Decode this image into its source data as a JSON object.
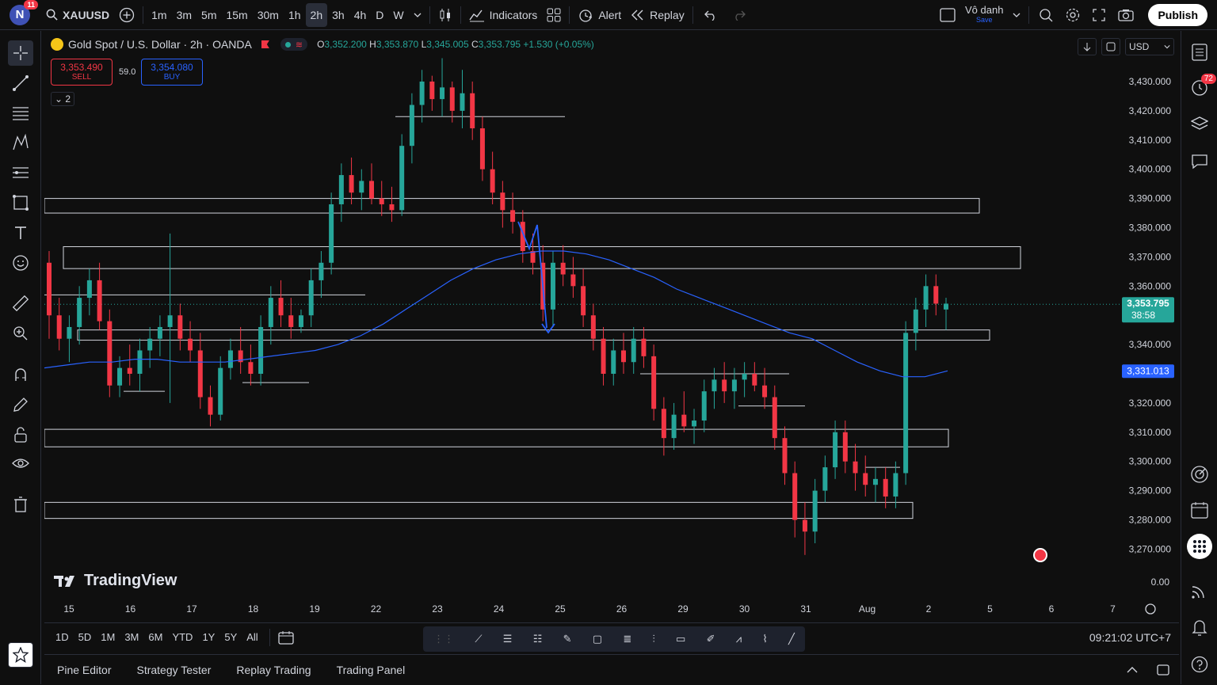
{
  "app": {
    "avatar_letter": "N",
    "notifications": "11",
    "symbol": "XAUUSD",
    "intervals": [
      "1m",
      "3m",
      "5m",
      "15m",
      "30m",
      "1h",
      "2h",
      "3h",
      "4h",
      "D",
      "W"
    ],
    "active_interval": "2h",
    "indicators_label": "Indicators",
    "alert_label": "Alert",
    "replay_label": "Replay",
    "layout_name": "Vô danh",
    "layout_status": "Save",
    "publish_label": "Publish"
  },
  "legend": {
    "title": "Gold Spot / U.S. Dollar · 2h · OANDA",
    "o_label": "O",
    "o": "3,352.200",
    "h_label": "H",
    "h": "3,353.870",
    "l_label": "L",
    "l": "3,345.005",
    "c_label": "C",
    "c": "3,353.795",
    "change": "+1.530 (+0.05%)",
    "sell_price": "3,353.490",
    "sell_label": "SELL",
    "spread": "59.0",
    "buy_price": "3,354.080",
    "buy_label": "BUY",
    "collapse_count": "2"
  },
  "price_scale": {
    "currency": "USD",
    "ticks": [
      "3,430.000",
      "3,420.000",
      "3,410.000",
      "3,400.000",
      "3,390.000",
      "3,380.000",
      "3,370.000",
      "3,360.000",
      "3,350.000",
      "3,340.000",
      "3,320.000",
      "3,310.000",
      "3,300.000",
      "3,290.000",
      "3,280.000",
      "3,270.000"
    ],
    "current_price": "3,353.795",
    "countdown": "38:58",
    "ma_price": "3,331.013",
    "zero_label": "0.00"
  },
  "time_scale": {
    "labels": [
      "15",
      "16",
      "17",
      "18",
      "19",
      "22",
      "23",
      "24",
      "25",
      "26",
      "29",
      "30",
      "31",
      "Aug",
      "2",
      "5",
      "6",
      "7"
    ]
  },
  "bottom": {
    "ranges": [
      "1D",
      "5D",
      "1M",
      "3M",
      "6M",
      "YTD",
      "1Y",
      "5Y",
      "All"
    ],
    "clock": "09:21:02 UTC+7"
  },
  "panels": [
    "Pine Editor",
    "Strategy Tester",
    "Replay Trading",
    "Trading Panel"
  ],
  "watermark": "TradingView",
  "right_badge": "72",
  "colors": {
    "up": "#26a69a",
    "down": "#f23645",
    "ma": "#2962ff",
    "bg": "#0f0f0f"
  },
  "chart_data": {
    "type": "candlestick",
    "title": "Gold Spot / U.S. Dollar · 2h · OANDA",
    "ylim": [
      3265,
      3440
    ],
    "ma_last": 3331.013,
    "last_close": 3353.795,
    "candles": [
      [
        3368,
        3372,
        3342,
        3350
      ],
      [
        3350,
        3356,
        3338,
        3342
      ],
      [
        3342,
        3350,
        3334,
        3346
      ],
      [
        3346,
        3360,
        3340,
        3356
      ],
      [
        3356,
        3366,
        3350,
        3362
      ],
      [
        3362,
        3368,
        3345,
        3348
      ],
      [
        3348,
        3352,
        3322,
        3326
      ],
      [
        3326,
        3336,
        3322,
        3332
      ],
      [
        3332,
        3340,
        3326,
        3330
      ],
      [
        3330,
        3342,
        3324,
        3338
      ],
      [
        3338,
        3346,
        3332,
        3342
      ],
      [
        3342,
        3350,
        3336,
        3346
      ],
      [
        3346,
        3378,
        3320,
        3350
      ],
      [
        3350,
        3354,
        3338,
        3342
      ],
      [
        3342,
        3348,
        3334,
        3338
      ],
      [
        3338,
        3344,
        3318,
        3322
      ],
      [
        3322,
        3326,
        3312,
        3316
      ],
      [
        3316,
        3336,
        3314,
        3332
      ],
      [
        3332,
        3342,
        3328,
        3338
      ],
      [
        3338,
        3346,
        3330,
        3334
      ],
      [
        3334,
        3340,
        3326,
        3330
      ],
      [
        3330,
        3350,
        3326,
        3346
      ],
      [
        3346,
        3360,
        3340,
        3356
      ],
      [
        3356,
        3362,
        3346,
        3350
      ],
      [
        3350,
        3356,
        3342,
        3346
      ],
      [
        3346,
        3352,
        3344,
        3350
      ],
      [
        3350,
        3366,
        3346,
        3362
      ],
      [
        3362,
        3372,
        3356,
        3368
      ],
      [
        3368,
        3392,
        3364,
        3388
      ],
      [
        3388,
        3402,
        3382,
        3398
      ],
      [
        3398,
        3404,
        3388,
        3392
      ],
      [
        3392,
        3400,
        3386,
        3396
      ],
      [
        3396,
        3402,
        3388,
        3390
      ],
      [
        3390,
        3396,
        3384,
        3388
      ],
      [
        3388,
        3394,
        3382,
        3386
      ],
      [
        3386,
        3412,
        3384,
        3408
      ],
      [
        3408,
        3426,
        3402,
        3422
      ],
      [
        3422,
        3434,
        3416,
        3430
      ],
      [
        3430,
        3432,
        3420,
        3424
      ],
      [
        3424,
        3438,
        3418,
        3428
      ],
      [
        3428,
        3430,
        3416,
        3420
      ],
      [
        3420,
        3434,
        3414,
        3426
      ],
      [
        3426,
        3430,
        3410,
        3414
      ],
      [
        3414,
        3418,
        3396,
        3400
      ],
      [
        3400,
        3406,
        3388,
        3392
      ],
      [
        3392,
        3396,
        3380,
        3386
      ],
      [
        3386,
        3392,
        3378,
        3382
      ],
      [
        3382,
        3386,
        3368,
        3372
      ],
      [
        3372,
        3378,
        3364,
        3368
      ],
      [
        3368,
        3374,
        3348,
        3352
      ],
      [
        3352,
        3372,
        3346,
        3368
      ],
      [
        3368,
        3374,
        3360,
        3364
      ],
      [
        3364,
        3370,
        3356,
        3360
      ],
      [
        3360,
        3366,
        3346,
        3350
      ],
      [
        3350,
        3354,
        3338,
        3342
      ],
      [
        3342,
        3346,
        3326,
        3330
      ],
      [
        3330,
        3342,
        3326,
        3338
      ],
      [
        3338,
        3344,
        3330,
        3334
      ],
      [
        3334,
        3346,
        3330,
        3342
      ],
      [
        3342,
        3346,
        3332,
        3336
      ],
      [
        3336,
        3340,
        3314,
        3318
      ],
      [
        3318,
        3322,
        3302,
        3308
      ],
      [
        3308,
        3320,
        3304,
        3316
      ],
      [
        3316,
        3324,
        3310,
        3312
      ],
      [
        3312,
        3318,
        3306,
        3314
      ],
      [
        3314,
        3328,
        3310,
        3324
      ],
      [
        3324,
        3332,
        3318,
        3328
      ],
      [
        3328,
        3334,
        3320,
        3324
      ],
      [
        3324,
        3332,
        3318,
        3328
      ],
      [
        3328,
        3334,
        3322,
        3330
      ],
      [
        3330,
        3334,
        3324,
        3326
      ],
      [
        3326,
        3332,
        3318,
        3322
      ],
      [
        3322,
        3326,
        3304,
        3308
      ],
      [
        3308,
        3312,
        3292,
        3296
      ],
      [
        3296,
        3300,
        3274,
        3280
      ],
      [
        3280,
        3286,
        3268,
        3276
      ],
      [
        3276,
        3294,
        3272,
        3290
      ],
      [
        3290,
        3302,
        3286,
        3298
      ],
      [
        3298,
        3314,
        3294,
        3310
      ],
      [
        3310,
        3314,
        3296,
        3300
      ],
      [
        3300,
        3306,
        3290,
        3296
      ],
      [
        3296,
        3302,
        3288,
        3292
      ],
      [
        3292,
        3298,
        3286,
        3294
      ],
      [
        3294,
        3298,
        3284,
        3288
      ],
      [
        3288,
        3300,
        3284,
        3296
      ],
      [
        3296,
        3348,
        3292,
        3344
      ],
      [
        3344,
        3356,
        3338,
        3352
      ],
      [
        3352,
        3364,
        3346,
        3360
      ],
      [
        3360,
        3364,
        3350,
        3354
      ],
      [
        3352,
        3356,
        3345,
        3354
      ]
    ]
  }
}
